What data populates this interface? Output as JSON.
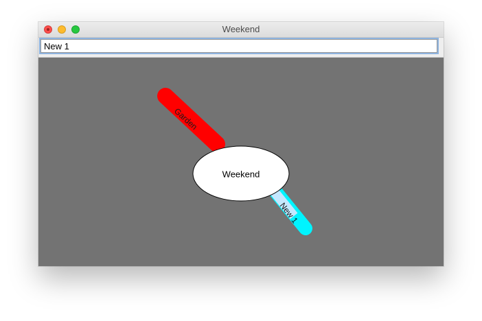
{
  "window": {
    "title": "Weekend"
  },
  "input": {
    "value": "New 1"
  },
  "mindmap": {
    "center_node": "Weekend",
    "branches": [
      {
        "label": "Garden",
        "color": "#ff0000"
      },
      {
        "label": "New 1",
        "color": "#00f4ff",
        "selected": true
      }
    ]
  },
  "colors": {
    "canvas": "#737373",
    "titlebar": "#e6e6e6",
    "selection": "#b3d4ff",
    "center_node_fill": "#ffffff"
  }
}
